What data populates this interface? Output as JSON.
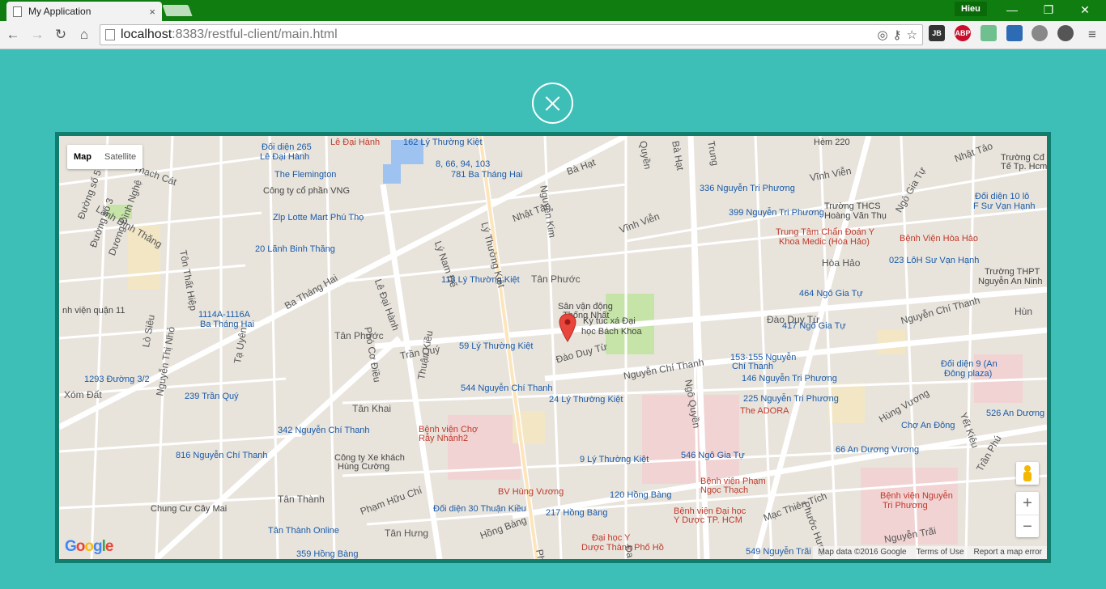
{
  "browser": {
    "tab_title": "My Application",
    "tab_close": "×",
    "profile": "Hieu",
    "url_host": "localhost",
    "url_path": ":8383/restful-client/main.html",
    "extensions": [
      "JB",
      "ABP"
    ],
    "window_controls": {
      "minimize": "—",
      "restore": "❐",
      "close": "✕"
    }
  },
  "map": {
    "type_control": {
      "map": "Map",
      "satellite": "Satellite"
    },
    "zoom_in": "+",
    "zoom_out": "−",
    "attribution": {
      "data": "Map data ©2016 Google",
      "terms": "Terms of Use",
      "report": "Report a map error"
    },
    "logo": "Google",
    "colors": {
      "accent": "#3dbfb8",
      "frame": "#117d6e",
      "pin": "#e8453c"
    },
    "poi": [
      {
        "text": "162 Lý Thường Kiệt",
        "style": "blue"
      },
      {
        "text": "8, 66, 94, 103",
        "style": "blue"
      },
      {
        "text": "781 Ba Tháng Hai",
        "style": "blue"
      },
      {
        "text": "Đối diện 265",
        "style": "blue"
      },
      {
        "text": "Lê Đại Hành",
        "style": "blue"
      },
      {
        "text": "Lê Đại Hành",
        "style": "red"
      },
      {
        "text": "The Flemington",
        "style": "blue"
      },
      {
        "text": "Công ty cổ phần VNG",
        "style": "dark"
      },
      {
        "text": "Zlp Lotte Mart Phú Thọ",
        "style": "blue"
      },
      {
        "text": "20 Lãnh Binh Thăng",
        "style": "blue"
      },
      {
        "text": "118 Lý Thường Kiệt",
        "style": "blue"
      },
      {
        "text": "1114A-1116A",
        "style": "blue"
      },
      {
        "text": "Ba Tháng Hai",
        "style": "blue"
      },
      {
        "text": "59 Lý Thường Kiệt",
        "style": "blue"
      },
      {
        "text": "Sân vận động",
        "style": "dark"
      },
      {
        "text": "Thống Nhất",
        "style": "dark"
      },
      {
        "text": "Ký túc xá Đại",
        "style": "dark"
      },
      {
        "text": "học Bách Khoa",
        "style": "dark"
      },
      {
        "text": "544 Nguyễn Chí Thanh",
        "style": "blue"
      },
      {
        "text": "24 Lý Thường Kiệt",
        "style": "blue"
      },
      {
        "text": "1293 Đường 3/2",
        "style": "blue"
      },
      {
        "text": "239 Trần Quý",
        "style": "blue"
      },
      {
        "text": "342 Nguyễn Chí Thanh",
        "style": "blue"
      },
      {
        "text": "Bệnh viện Chợ",
        "style": "red"
      },
      {
        "text": "Rẫy Nhánh2",
        "style": "red"
      },
      {
        "text": "816 Nguyễn Chí Thanh",
        "style": "blue"
      },
      {
        "text": "Công ty Xe khách",
        "style": "dark"
      },
      {
        "text": "Hùng Cường",
        "style": "dark"
      },
      {
        "text": "9 Lý Thường Kiệt",
        "style": "blue"
      },
      {
        "text": "BV Hùng Vương",
        "style": "red"
      },
      {
        "text": "120 Hồng Bàng",
        "style": "blue"
      },
      {
        "text": "Đối diện 30 Thuận Kiều",
        "style": "blue"
      },
      {
        "text": "217 Hồng Bàng",
        "style": "blue"
      },
      {
        "text": "Chung Cư Cây Mai",
        "style": "dark"
      },
      {
        "text": "Tân Thành Online",
        "style": "blue"
      },
      {
        "text": "359 Hồng Bàng",
        "style": "blue"
      },
      {
        "text": "Đại học Y",
        "style": "red"
      },
      {
        "text": "Dược Thành Phố Hồ",
        "style": "red"
      },
      {
        "text": "549 Nguyễn Trãi",
        "style": "blue"
      },
      {
        "text": "Bệnh viện Đại học",
        "style": "red"
      },
      {
        "text": "Y Dược TP. HCM",
        "style": "red"
      },
      {
        "text": "Bệnh viện Phạm",
        "style": "red"
      },
      {
        "text": "Ngọc Thạch",
        "style": "red"
      },
      {
        "text": "546 Ngô Gia Tự",
        "style": "blue"
      },
      {
        "text": "66 An Dương Vương",
        "style": "blue"
      },
      {
        "text": "The ADORA",
        "style": "red"
      },
      {
        "text": "225 Nguyễn Tri Phương",
        "style": "blue"
      },
      {
        "text": "146 Nguyễn Tri Phương",
        "style": "blue"
      },
      {
        "text": "153-155 Nguyễn",
        "style": "blue"
      },
      {
        "text": "Chí Thanh",
        "style": "blue"
      },
      {
        "text": "417 Ngô Gia Tự",
        "style": "blue"
      },
      {
        "text": "464 Ngô Gia Tự",
        "style": "blue"
      },
      {
        "text": "336 Nguyễn Tri Phương",
        "style": "blue"
      },
      {
        "text": "399 Nguyễn Tri Phương",
        "style": "blue"
      },
      {
        "text": "Trường THCS",
        "style": "dark"
      },
      {
        "text": "Hoàng Văn Thụ",
        "style": "dark"
      },
      {
        "text": "Trung Tâm Chẩn Đoán Y",
        "style": "red"
      },
      {
        "text": "Khoa Medic (Hòa Hảo)",
        "style": "red"
      },
      {
        "text": "Bệnh Viện Hòa Hảo",
        "style": "red"
      },
      {
        "text": "023 LôH Sư Vạn Hạnh",
        "style": "blue"
      },
      {
        "text": "Đối diện 10 lô",
        "style": "blue"
      },
      {
        "text": "F Sư Vạn Hạnh",
        "style": "blue"
      },
      {
        "text": "Trường Cđ I",
        "style": "dark"
      },
      {
        "text": "Tế Tp. Hcm",
        "style": "dark"
      },
      {
        "text": "Trường THPT",
        "style": "dark"
      },
      {
        "text": "Nguyễn An Ninh",
        "style": "dark"
      },
      {
        "text": "Đối diện 9 (An",
        "style": "blue"
      },
      {
        "text": "Đông plaza)",
        "style": "blue"
      },
      {
        "text": "526 An Dương",
        "style": "blue"
      },
      {
        "text": "Chợ An Đông",
        "style": "blue"
      },
      {
        "text": "Bệnh viện Nguyễn",
        "style": "red"
      },
      {
        "text": "Tri Phương",
        "style": "red"
      },
      {
        "text": "Hèm 220",
        "style": "dark"
      },
      {
        "text": "nh viện quận 11",
        "style": "dark"
      }
    ],
    "streets": [
      "Thạch Cát",
      "Lãnh Bình Thăng",
      "Đường số 5",
      "Đường số 3",
      "Dương Đình Nghệ",
      "Tôn Thất Hiệp",
      "Ba Tháng Hai",
      "Lê Đại Hành",
      "Lý Nam Đế",
      "Lý Thường Kiệt",
      "Nhật Tảo",
      "Nguyễn Kim",
      "Bà Hạt",
      "Vĩnh Viễn",
      "Tân Phước",
      "Phó Cơ Điều",
      "Trần Quý",
      "Tân Phước",
      "Đào Duy Từ",
      "Nguyễn Chí Thanh",
      "Thuận Kiều",
      "Tân Khai",
      "Lò Siêu",
      "Xóm Đất",
      "Tạ Uyên",
      "Nguyễn Thị Nhỏ",
      "Tân Thành",
      "Phạm Hữu Chí",
      "Tân Hưng",
      "Hồng Bàng",
      "Ngô Quyền",
      "Hùng Vương",
      "Mạc Thiên Tích",
      "Phước Hưng",
      "Trần Phú",
      "Yết Kiêu",
      "Nguyễn Trãi",
      "Hòa Hảo",
      "Ngô Gia Tự",
      "Nhật Tảo",
      "Vĩnh Viễn",
      "Đào Duy Từ",
      "Nguyễn Chí Thanh",
      "Quyền",
      "Bà Hạt",
      "Trung",
      "Phục",
      "Đa",
      "Hùn"
    ]
  }
}
